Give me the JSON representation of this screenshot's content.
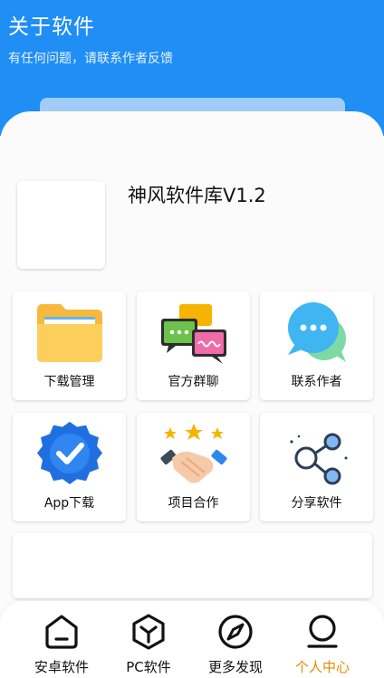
{
  "header": {
    "title": "关于软件",
    "subtitle": "有任何问题，请联系作者反馈"
  },
  "app": {
    "name": "神风软件库V1.2"
  },
  "grid": [
    {
      "label": "下载管理",
      "icon": "folder-icon"
    },
    {
      "label": "官方群聊",
      "icon": "group-chat-icon"
    },
    {
      "label": "联系作者",
      "icon": "chat-bubble-icon"
    },
    {
      "label": "App下载",
      "icon": "verified-badge-icon"
    },
    {
      "label": "项目合作",
      "icon": "handshake-icon"
    },
    {
      "label": "分享软件",
      "icon": "share-icon"
    }
  ],
  "tabbar": {
    "items": [
      {
        "label": "安卓软件",
        "icon": "home-icon"
      },
      {
        "label": "PC软件",
        "icon": "box-icon"
      },
      {
        "label": "更多发现",
        "icon": "compass-icon"
      },
      {
        "label": "个人中心",
        "icon": "user-icon"
      }
    ],
    "active_index": 3
  },
  "colors": {
    "header_bg": "#1f8ef5",
    "active_tab": "#e58a00"
  }
}
